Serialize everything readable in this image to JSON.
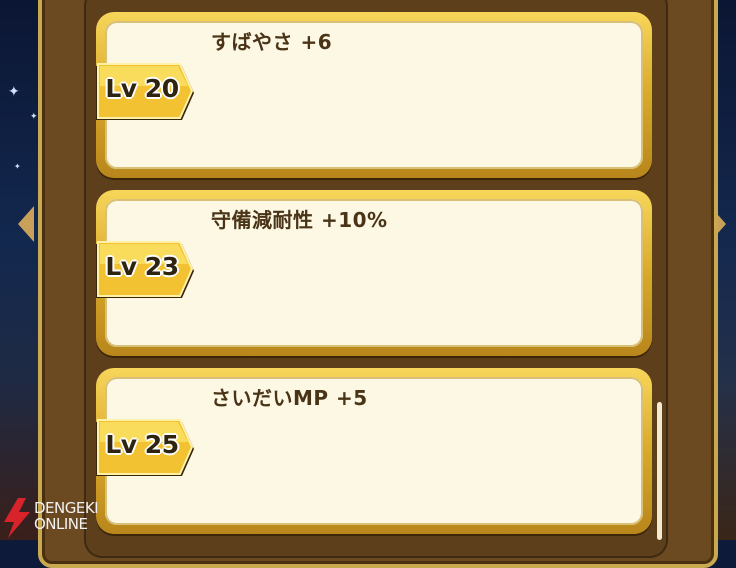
{
  "skills": [
    {
      "level_label": "Lv 20",
      "effect": "すばやさ +6"
    },
    {
      "level_label": "Lv 23",
      "effect": "守備減耐性 +10%"
    },
    {
      "level_label": "Lv 25",
      "effect": "さいだいMP +5"
    }
  ],
  "watermark": {
    "line1": "DENGEKI",
    "line2": "ONLINE"
  },
  "icons": {
    "prev": "left-arrow-icon",
    "next": "right-arrow-icon"
  },
  "colors": {
    "card_fill": "#fdf8e4",
    "gold": "#f0c23a",
    "frame_brown": "#5e3f1c",
    "text": "#4a3418"
  }
}
